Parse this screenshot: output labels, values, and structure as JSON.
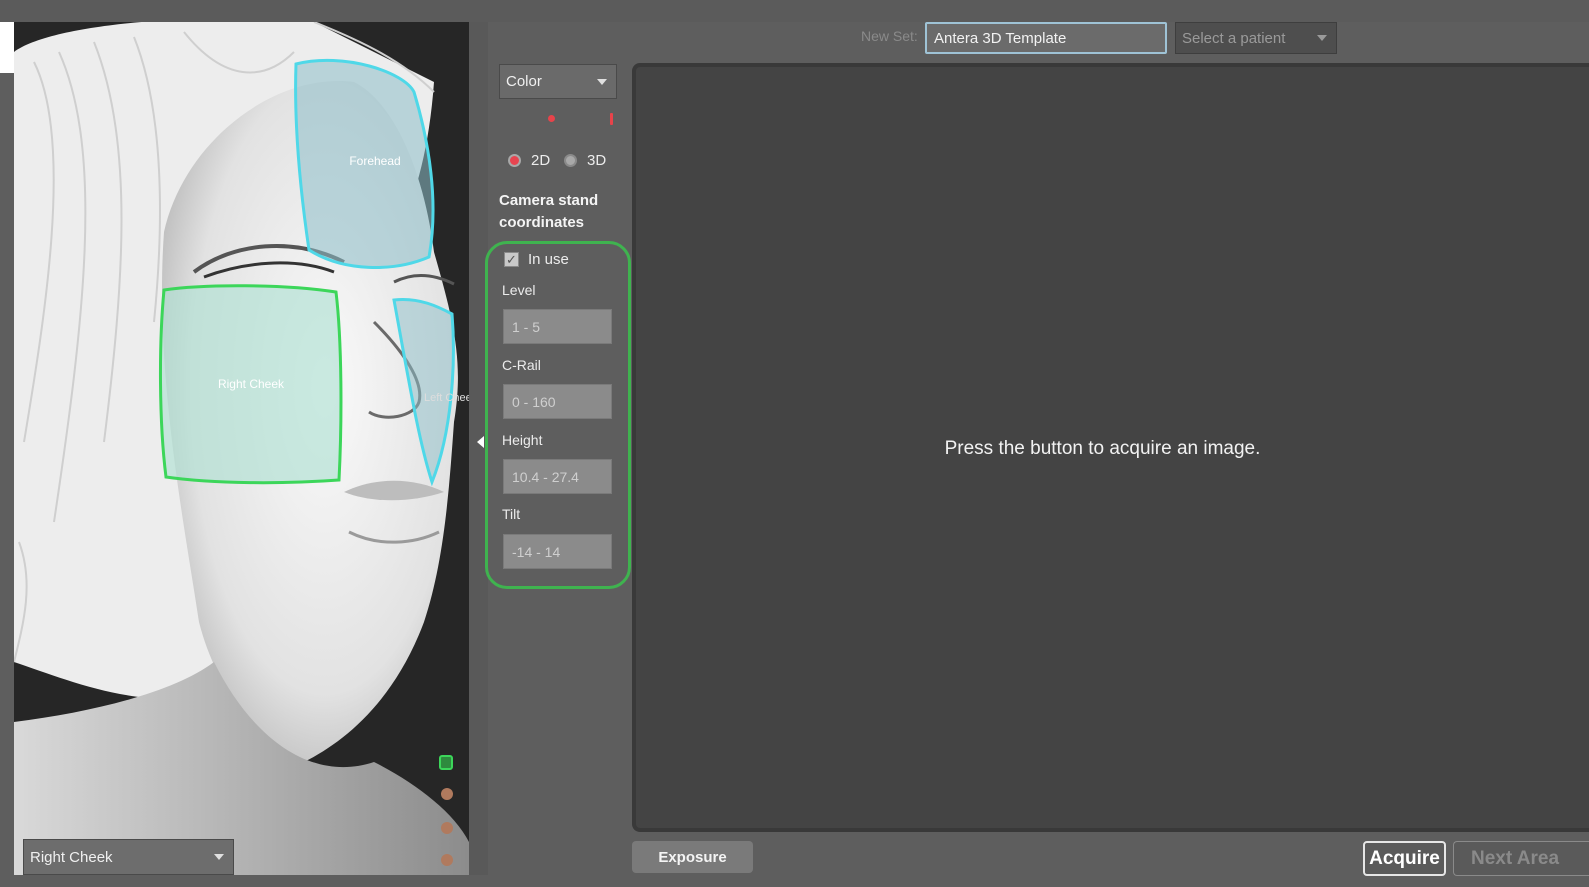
{
  "viewer": {
    "regions": [
      {
        "name": "Forehead",
        "color": "#4fd8e8"
      },
      {
        "name": "Right Cheek",
        "color": "#3cd65a"
      },
      {
        "name": "Left Cheek",
        "color": "#4fd8e8"
      }
    ],
    "region_select": {
      "value": "Right Cheek"
    }
  },
  "capture": {
    "mode_select": {
      "value": "Color"
    },
    "dimension": {
      "options": [
        "2D",
        "3D"
      ],
      "selected": "2D"
    }
  },
  "camera_stand": {
    "title_line1": "Camera stand",
    "title_line2": "coordinates",
    "in_use_label": "In use",
    "in_use_checked": true,
    "fields": [
      {
        "label": "Level",
        "placeholder": "1 - 5"
      },
      {
        "label": "C-Rail",
        "placeholder": "0 - 160"
      },
      {
        "label": "Height",
        "placeholder": "10.4 - 27.4"
      },
      {
        "label": "Tilt",
        "placeholder": "-14 - 14"
      }
    ],
    "highlight_color": "#3fb34f"
  },
  "header": {
    "new_set_label": "New Set:",
    "template_value": "Antera 3D Template",
    "patient_placeholder": "Select a patient"
  },
  "main": {
    "prompt": "Press the button to acquire an image."
  },
  "actions": {
    "exposure_label": "Exposure",
    "acquire_label": "Acquire",
    "next_area_label": "Next Area"
  }
}
